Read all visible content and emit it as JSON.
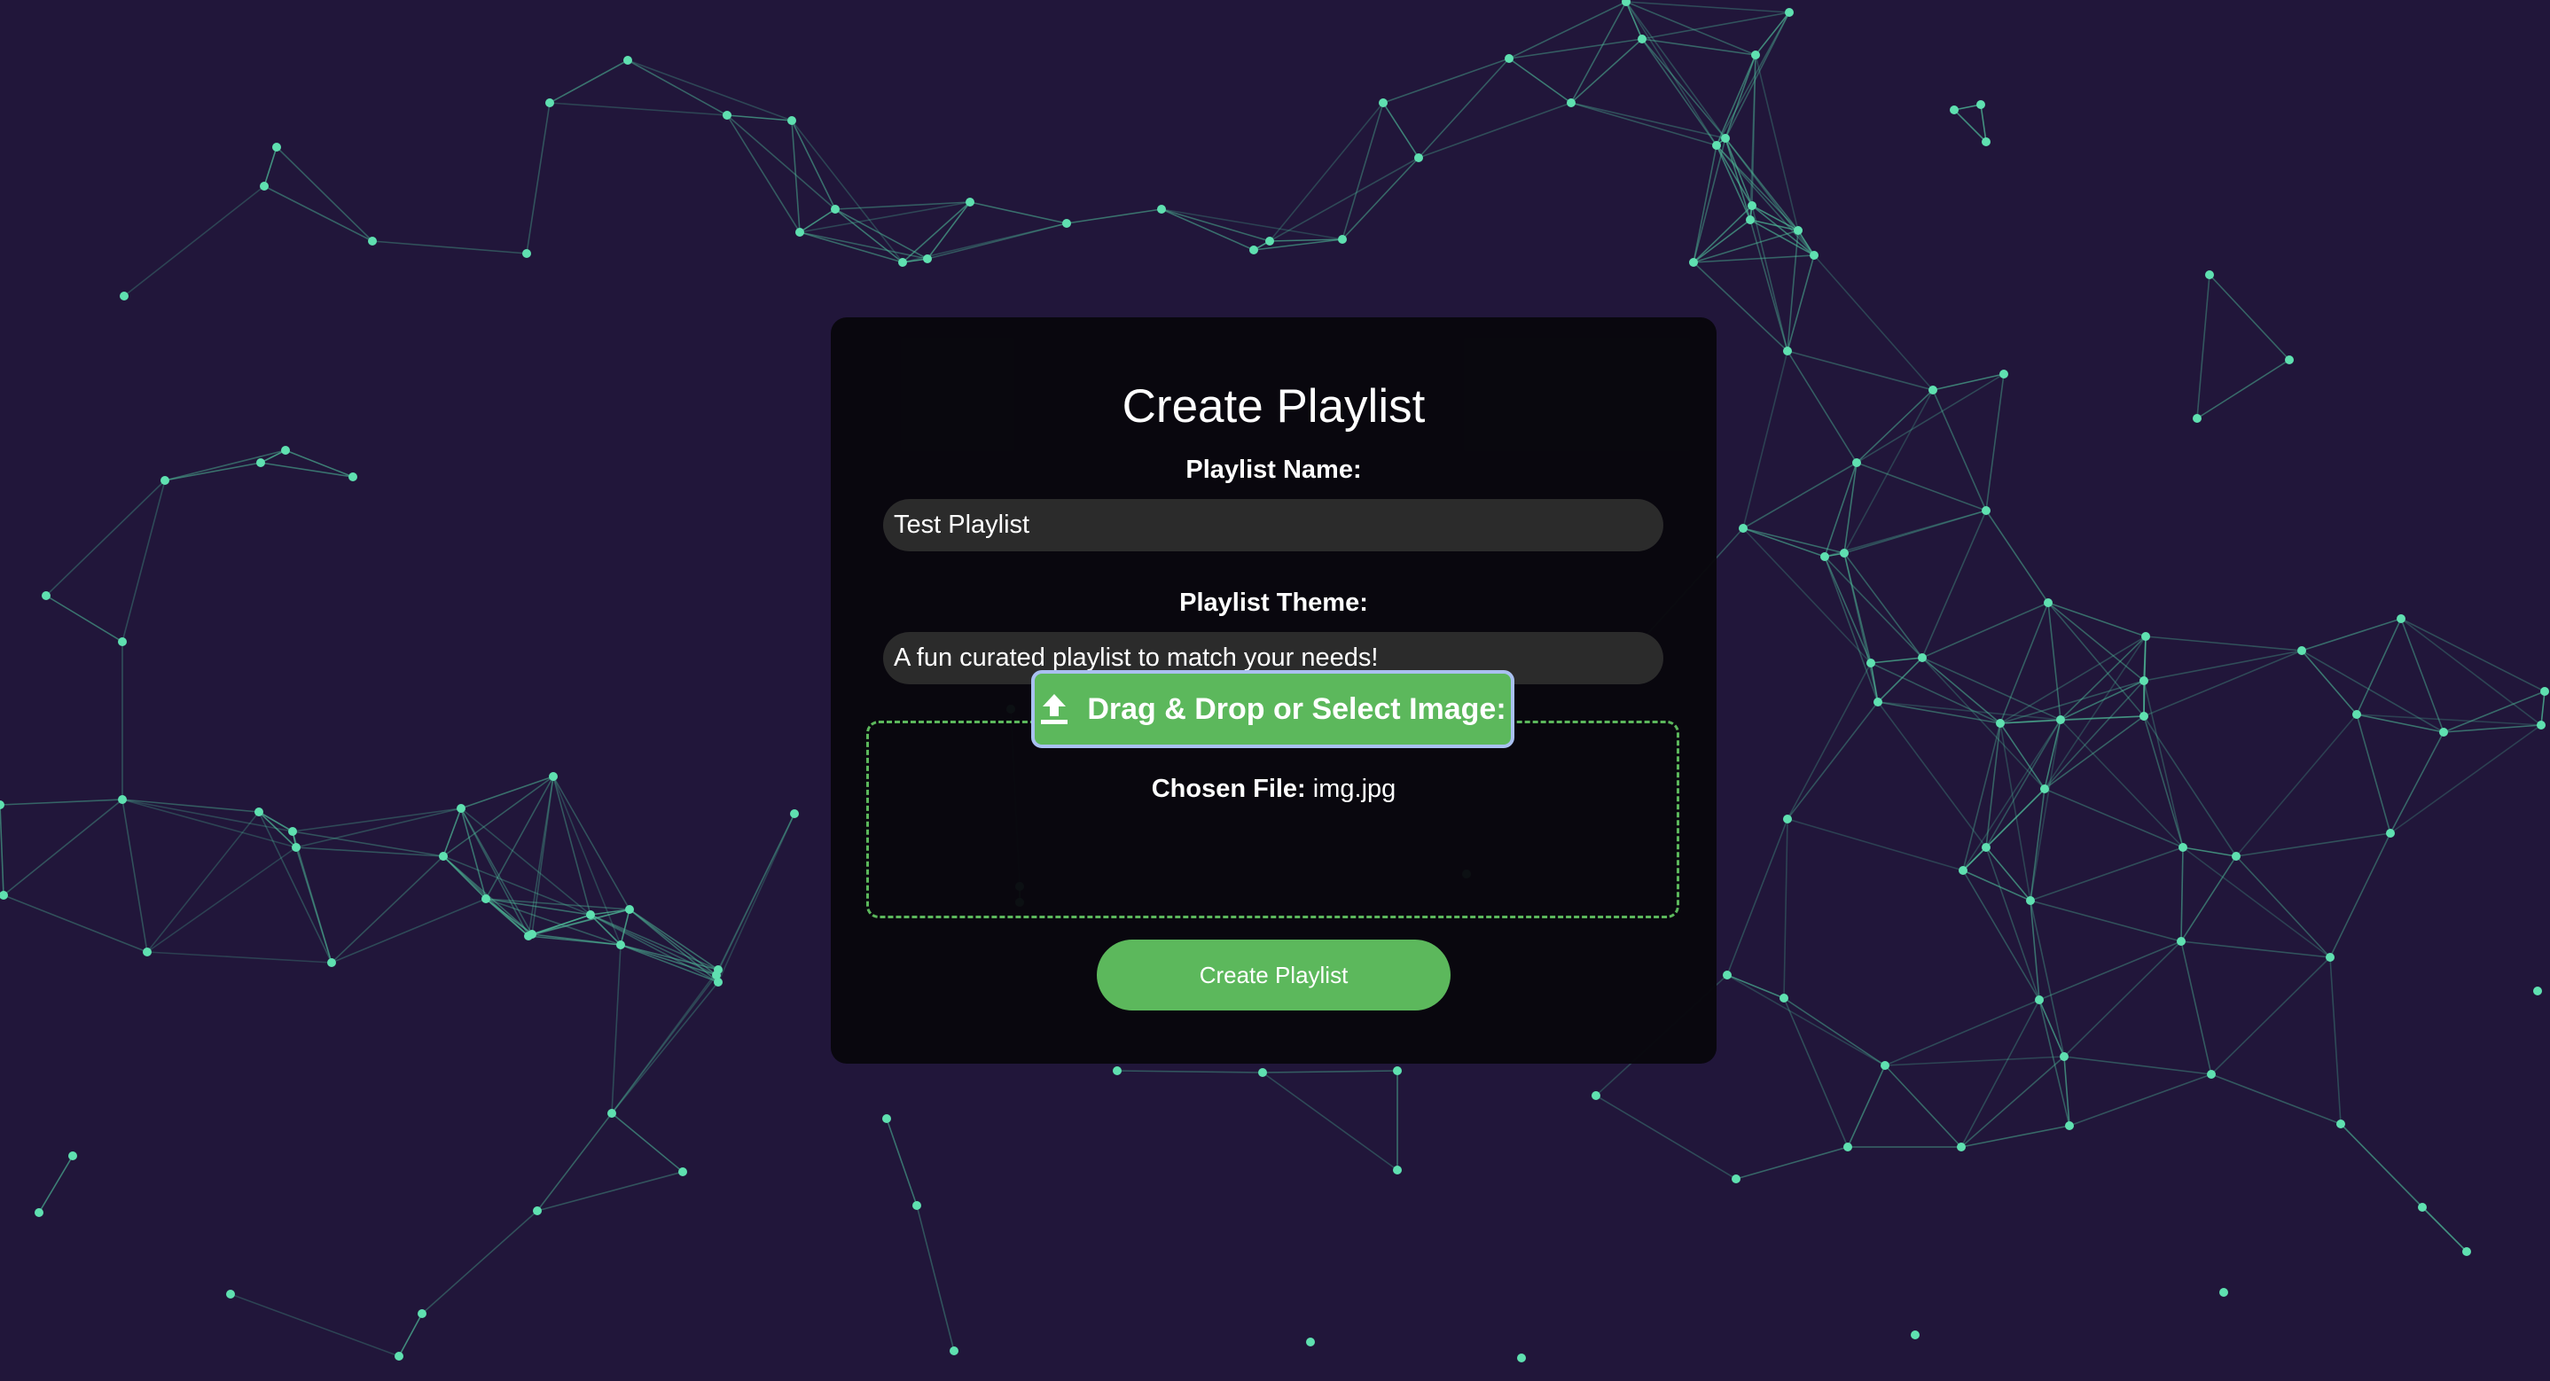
{
  "background": {
    "color": "#21163a",
    "node_color": "#5fe0b0",
    "line_color": "#4fbf9a"
  },
  "form": {
    "title": "Create Playlist",
    "name_label": "Playlist Name:",
    "name_value": "Test Playlist",
    "theme_label": "Playlist Theme:",
    "theme_value": "A fun curated playlist to match your needs!",
    "upload": {
      "button_label": "Drag & Drop or Select Image:",
      "icon": "upload-icon",
      "chosen_label": "Chosen File:",
      "chosen_value": "img.jpg"
    },
    "submit_label": "Create Playlist"
  },
  "colors": {
    "accent": "#5cb85c",
    "card": "#08070c",
    "input_bg": "#2b2b2b",
    "upload_border": "#a9c0f0"
  }
}
